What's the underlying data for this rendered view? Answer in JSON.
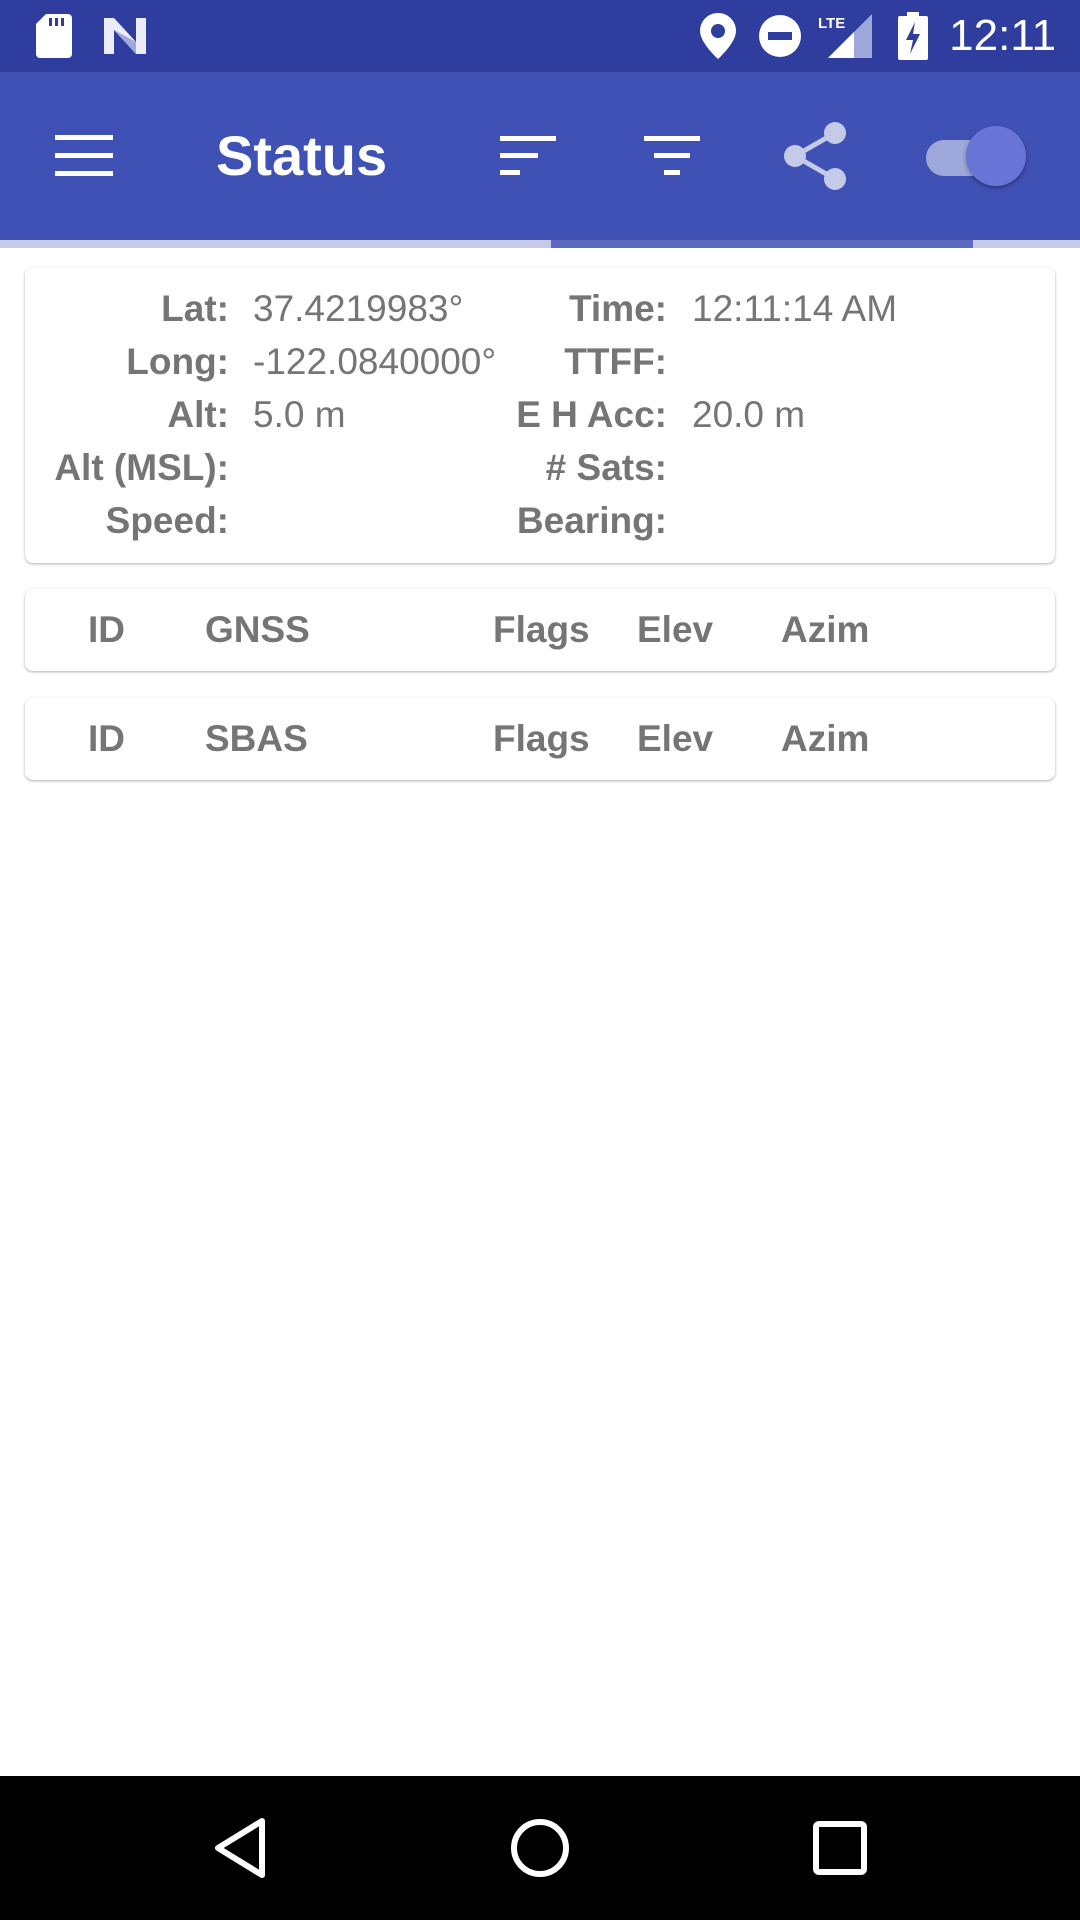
{
  "status_bar": {
    "time": "12:11",
    "network_label": "LTE",
    "icons": [
      "sd-card-icon",
      "n-logo-icon",
      "location-pin-icon",
      "do-not-disturb-icon",
      "cell-signal-icon",
      "battery-charging-icon"
    ]
  },
  "app_bar": {
    "title": "Status",
    "actions": [
      "sort-icon",
      "filter-icon",
      "share-icon",
      "gps-toggle"
    ],
    "toggle_on": true,
    "colors": {
      "primary": "#3f51b5",
      "primary_dark": "#2f3e9e",
      "accent": "#6874d6"
    }
  },
  "location": {
    "lat_label": "Lat:",
    "lat_value": "37.4219983°",
    "long_label": "Long:",
    "long_value": "-122.0840000°",
    "alt_label": "Alt:",
    "alt_value": "5.0 m",
    "alt_msl_label": "Alt (MSL):",
    "alt_msl_value": "",
    "speed_label": "Speed:",
    "speed_value": "",
    "time_label": "Time:",
    "time_value": "12:11:14 AM",
    "ttff_label": "TTFF:",
    "ttff_value": "",
    "acc_label": "E H Acc:",
    "acc_value": "20.0 m",
    "sats_label": "# Sats:",
    "sats_value": "",
    "bearing_label": "Bearing:",
    "bearing_value": ""
  },
  "gnss_table": {
    "columns": [
      "ID",
      "GNSS",
      "Flags",
      "Elev",
      "Azim"
    ]
  },
  "sbas_table": {
    "columns": [
      "ID",
      "SBAS",
      "Flags",
      "Elev",
      "Azim"
    ]
  },
  "nav_bar": {
    "buttons": [
      "back-icon",
      "home-icon",
      "recents-icon"
    ]
  }
}
